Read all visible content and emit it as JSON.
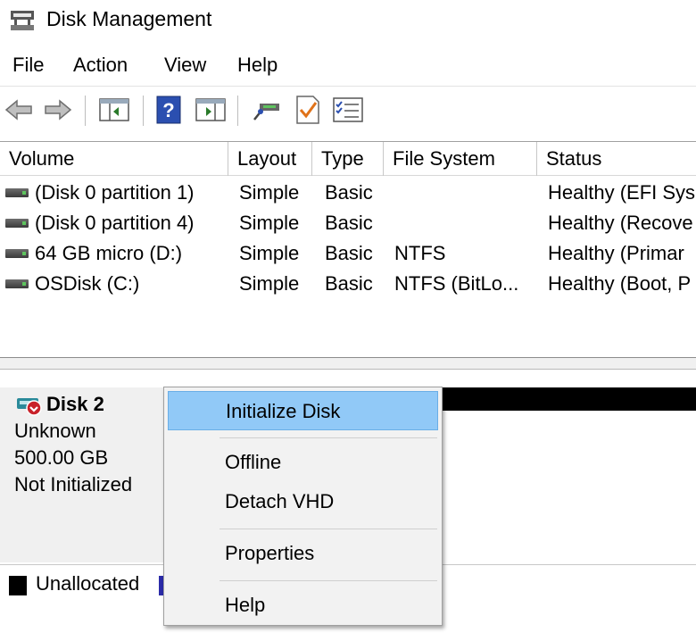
{
  "window": {
    "title": "Disk Management"
  },
  "menu": [
    "File",
    "Action",
    "View",
    "Help"
  ],
  "toolbar": {
    "buttons": [
      "back-icon",
      "forward-icon",
      "console-tree-icon",
      "help-icon",
      "action-pane-icon",
      "connect-icon",
      "checkmark-icon",
      "properties-list-icon"
    ]
  },
  "columns": [
    "Volume",
    "Layout",
    "Type",
    "File System",
    "Status"
  ],
  "volumes": [
    {
      "volume": "(Disk 0 partition 1)",
      "layout": "Simple",
      "type": "Basic",
      "filesystem": "",
      "status": "Healthy (EFI Sys"
    },
    {
      "volume": "(Disk 0 partition 4)",
      "layout": "Simple",
      "type": "Basic",
      "filesystem": "",
      "status": "Healthy (Recove"
    },
    {
      "volume": "64 GB micro (D:)",
      "layout": "Simple",
      "type": "Basic",
      "filesystem": "NTFS",
      "status": "Healthy (Primar"
    },
    {
      "volume": "OSDisk (C:)",
      "layout": "Simple",
      "type": "Basic",
      "filesystem": "NTFS (BitLo...",
      "status": "Healthy (Boot, P"
    }
  ],
  "disk": {
    "name": "Disk 2",
    "kind": "Unknown",
    "size": "500.00 GB",
    "state": "Not Initialized"
  },
  "legend": {
    "unallocated": "Unallocated"
  },
  "context_menu": {
    "items": [
      "Initialize Disk",
      "Offline",
      "Detach VHD",
      "Properties",
      "Help"
    ],
    "highlighted": "Initialize Disk"
  },
  "colors": {
    "highlight": "#91c9f7",
    "unallocated": "#000000",
    "primary": "#2b2ba8"
  }
}
